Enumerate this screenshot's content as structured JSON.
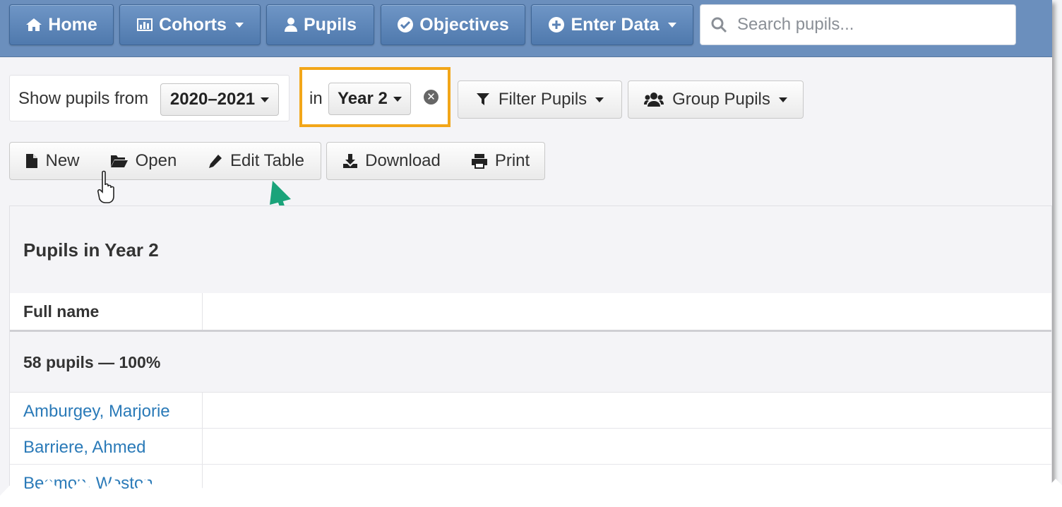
{
  "nav": {
    "home": "Home",
    "cohorts": "Cohorts",
    "pupils": "Pupils",
    "objectives": "Objectives",
    "enter_data": "Enter Data",
    "search_placeholder": "Search pupils..."
  },
  "filters": {
    "show_label": "Show pupils from",
    "year_range": "2020–2021",
    "in_label": "in",
    "year_group": "Year 2",
    "filter_pupils": "Filter Pupils",
    "group_pupils": "Group Pupils"
  },
  "toolbar": {
    "new": "New",
    "open": "Open",
    "edit_table": "Edit Table",
    "download": "Download",
    "print": "Print"
  },
  "table": {
    "title": "Pupils in Year 2",
    "column_header": "Full name",
    "summary": "58 pupils — 100%",
    "rows": [
      "Amburgey, Marjorie",
      "Barriere, Ahmed",
      "Beamon, Weston"
    ]
  },
  "colors": {
    "navbar": "#6b8fbd",
    "highlight_box": "#f2a619",
    "arrow": "#1aa37a",
    "link": "#2a7ab8"
  },
  "icons": [
    "home-icon",
    "chart-icon",
    "user-icon",
    "check-circle-icon",
    "plus-circle-icon",
    "search-icon",
    "filter-icon",
    "users-icon",
    "file-icon",
    "folder-open-icon",
    "pencil-icon",
    "download-icon",
    "print-icon",
    "close-circle-icon",
    "hand-cursor-icon"
  ]
}
